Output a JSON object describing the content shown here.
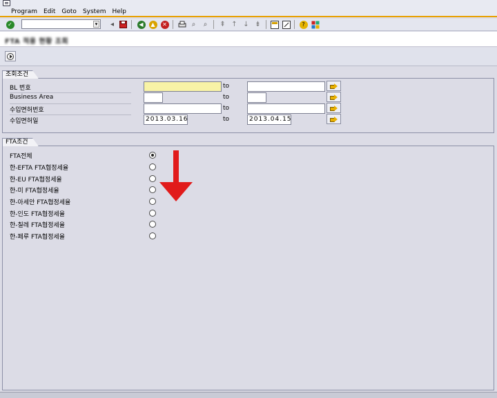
{
  "menu": {
    "items": [
      "Program",
      "Edit",
      "Goto",
      "System",
      "Help"
    ]
  },
  "toolbar": {
    "command_field_value": "",
    "icons": [
      "enter-check-icon",
      "save-icon",
      "back-icon",
      "exit-icon",
      "cancel-icon",
      "print-icon",
      "find-icon",
      "find-next-icon",
      "first-page-icon",
      "previous-page-icon",
      "next-page-icon",
      "last-page-icon",
      "create-session-icon",
      "shortcut-icon",
      "help-icon",
      "layout-icon"
    ]
  },
  "title": {
    "text": "FTA 적용 현황 조회"
  },
  "app_toolbar": {
    "execute_icon": "execute-icon"
  },
  "selection": {
    "group_title": "조회조건",
    "to_label": "to",
    "rows": [
      {
        "label": "BL 번호",
        "from": "",
        "to": ""
      },
      {
        "label": "Business Area",
        "from": "",
        "to": ""
      },
      {
        "label": "수입면허번호",
        "from": "",
        "to": ""
      },
      {
        "label": "수입면허일",
        "from": "2013.03.16",
        "to": "2013.04.15"
      }
    ]
  },
  "fta": {
    "group_title": "FTA조건",
    "options": [
      {
        "label": "FTA전체",
        "checked": true
      },
      {
        "label": "한-EFTA FTA협정세율",
        "checked": false
      },
      {
        "label": "한-EU FTA협정세율",
        "checked": false
      },
      {
        "label": "한-미 FTA협정세율",
        "checked": false
      },
      {
        "label": "한-아세안 FTA협정세율",
        "checked": false
      },
      {
        "label": "한-인도 FTA협정세율",
        "checked": false
      },
      {
        "label": "한-칠레 FTA협정세율",
        "checked": false
      },
      {
        "label": "한-페루 FTA협정세율",
        "checked": false
      }
    ]
  },
  "colors": {
    "background": "#dcdce6",
    "required_field": "#f8f3a6",
    "accent_line": "#e8a000",
    "annotation_arrow": "#e11b1b"
  }
}
